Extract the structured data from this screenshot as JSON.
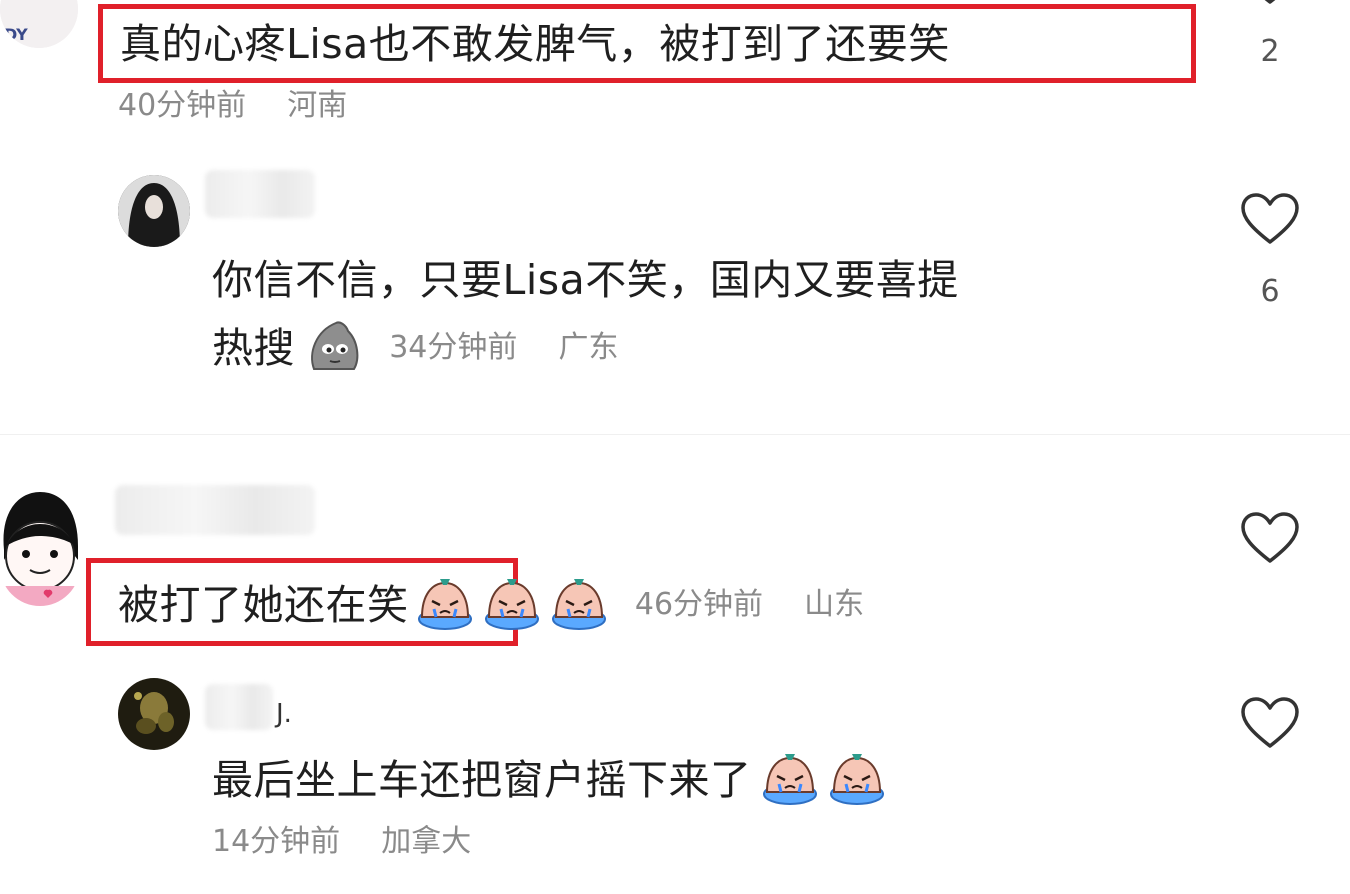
{
  "comments": [
    {
      "text": "真的心疼Lisa也不敢发脾气，被打到了还要笑",
      "time": "40分钟前",
      "location": "河南",
      "likes": "2",
      "highlighted": true
    },
    {
      "text_line1": "你信不信，只要Lisa不笑，国内又要喜提",
      "text_line2": "热搜",
      "time": "34分钟前",
      "location": "广东",
      "likes": "6",
      "is_reply": true
    },
    {
      "text": "被打了她还在笑",
      "time": "46分钟前",
      "location": "山东",
      "highlighted": true
    },
    {
      "text": "最后坐上车还把窗户摇下来了",
      "time": "14分钟前",
      "location": "加拿大",
      "name_suffix": "J.",
      "is_reply": true
    }
  ],
  "colors": {
    "highlight_border": "#e0202a",
    "meta_text": "#8a8a8a",
    "heart_stroke": "#333333"
  },
  "icons": {
    "like": "heart-outline-icon",
    "cry_sticker": "crying-face-sticker",
    "sly_sticker": "sly-face-sticker"
  }
}
